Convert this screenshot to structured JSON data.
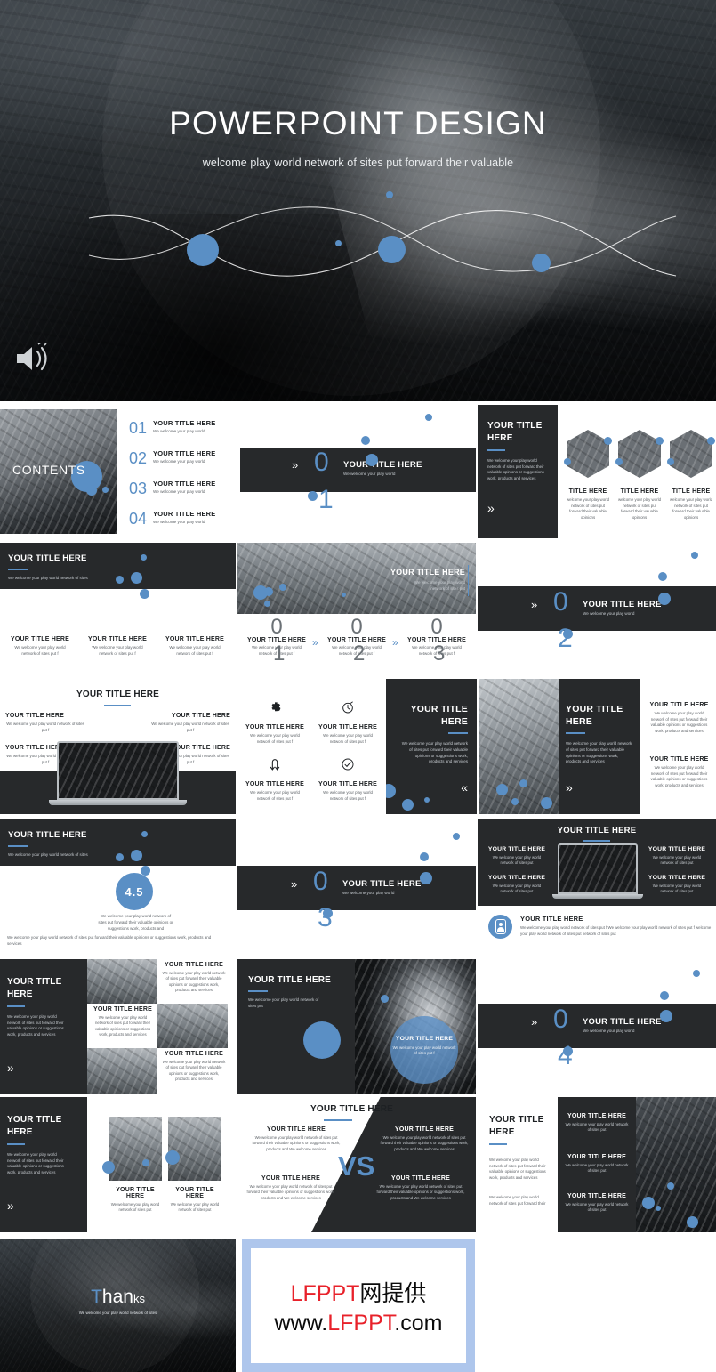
{
  "hero": {
    "title": "POWERPOINT DESIGN",
    "subtitle": "welcome play world network of sites put forward their valuable",
    "speaker_icon": "speaker-icon"
  },
  "accent_color": "#5a8fc5",
  "dark_color": "#27292b",
  "common": {
    "title": "YOUR TITLE HERE",
    "short_body": "We welcome your play world",
    "body_1": "We welcome your play world network of sites",
    "body_2": "We welcome your play world network of sites put f",
    "body_3": "We welcome your play world network of sites put forward their valuable opinions or suggestions work, products and services",
    "body_4": "We welcome your play world network of sites put forward their valuable opinions or suggestions work, products and",
    "body_5": "We welcome your play world network of sites put",
    "body_6": "We welcome your play world network of sites put forward their valuable opinions or suggestions work, products and We welcome services",
    "body_7": "We welcome your play world network of sites put forward their",
    "chevron_right": "»",
    "chevron_left": "«"
  },
  "slides": {
    "contents": {
      "label": "CONTENTS",
      "items": [
        {
          "num": "01",
          "title": "YOUR TITLE HERE",
          "body": "We welcome your play world"
        },
        {
          "num": "02",
          "title": "YOUR TITLE HERE",
          "body": "We welcome your play world"
        },
        {
          "num": "03",
          "title": "YOUR TITLE HERE",
          "body": "We welcome your play world"
        },
        {
          "num": "04",
          "title": "YOUR TITLE HERE",
          "body": "We welcome your play world"
        }
      ]
    },
    "section_1": {
      "zero": "0",
      "digit": "1",
      "title": "YOUR TITLE HERE",
      "body": "We welcome your play world"
    },
    "section_2": {
      "zero": "0",
      "digit": "2",
      "title": "YOUR TITLE HERE",
      "body": "We welcome your play world"
    },
    "section_3": {
      "zero": "0",
      "digit": "3",
      "title": "YOUR TITLE HERE",
      "body": "We welcome your play world"
    },
    "section_4": {
      "zero": "0",
      "digit": "4",
      "title": "YOUR TITLE HERE",
      "body": "We welcome your play world"
    },
    "intro_dark": {
      "title_line1": "YOUR TITLE",
      "title_line2": "HERE",
      "body": "We welcome your play world network of sites put forward their valuable opinions or suggestions work, products and services"
    },
    "team": {
      "members": [
        {
          "name": "TITLE HERE",
          "body": "welcome your play world network of sites put forward their valuable opinions"
        },
        {
          "name": "TITLE HERE",
          "body": "welcome your play world network of sites put forward their valuable opinions"
        },
        {
          "name": "TITLE HERE",
          "body": "welcome your play world network of sites put forward their valuable opinions"
        }
      ]
    },
    "three_col": {
      "header": "YOUR TITLE HERE",
      "header_body": "We welcome your play world network of sites",
      "cols": [
        {
          "title": "YOUR TITLE HERE",
          "body": "We welcome your play world network of sites put f"
        },
        {
          "title": "YOUR TITLE HERE",
          "body": "We welcome your play world network of sites put f"
        },
        {
          "title": "YOUR TITLE HERE",
          "body": "We welcome your play world network of sites put f"
        }
      ]
    },
    "steps": {
      "image_title": "YOUR TITLE HERE",
      "image_body": "We welcome your play world network of sites put",
      "items": [
        {
          "num": "0",
          "digit": "1",
          "title": "YOUR TITLE HERE",
          "body": "We welcome your play world network of sites put f"
        },
        {
          "num": "0",
          "digit": "2",
          "title": "YOUR TITLE HERE",
          "body": "We welcome your play world network of sites put f"
        },
        {
          "num": "0",
          "digit": "3",
          "title": "YOUR TITLE HERE",
          "body": "We welcome your play world network of sites put f"
        }
      ]
    },
    "laptop_four": {
      "header": "YOUR TITLE HERE",
      "items": [
        {
          "title": "YOUR TITLE HERE",
          "body": "We welcome your play world network of sites put f"
        },
        {
          "title": "YOUR TITLE HERE",
          "body": "We welcome your play world network of sites put f"
        },
        {
          "title": "YOUR TITLE HERE",
          "body": "We welcome your play world network of sites put f"
        },
        {
          "title": "YOUR TITLE HERE",
          "body": "We welcome your play world network of sites put f"
        }
      ]
    },
    "icons_four": {
      "items": [
        {
          "icon": "gear-icon",
          "title": "YOUR TITLE HERE",
          "body": "We welcome your play world network of sites put f"
        },
        {
          "icon": "stopwatch-icon",
          "title": "YOUR TITLE HERE",
          "body": "We welcome your play world network of sites put f"
        },
        {
          "icon": "exchange-arrows-icon",
          "title": "YOUR TITLE HERE",
          "body": "We welcome your play world network of sites put f"
        },
        {
          "icon": "check-circle-icon",
          "title": "YOUR TITLE HERE",
          "body": "We welcome your play world network of sites put f"
        }
      ]
    },
    "dark_text_panel": {
      "title_line1": "YOUR TITLE",
      "title_line2": "HERE",
      "body": "We welcome your play world network of sites put forward their valuable opinions or suggestions work, products and services"
    },
    "photo_text_panel": {
      "title_line1": "YOUR TITLE",
      "title_line2": "HERE",
      "body": "We welcome your play world network of sites put forward their valuable opinions or suggestions work, products and services"
    },
    "two_block_right": {
      "items": [
        {
          "title": "YOUR TITLE HERE",
          "body": "We welcome your play world network of sites put forward their valuable opinions or suggestions work, products and services"
        },
        {
          "title": "YOUR TITLE HERE",
          "body": "We welcome your play world network of sites put forward their valuable opinions or suggestions work, products and services"
        }
      ]
    },
    "rating": {
      "header": "YOUR TITLE HERE",
      "header_body": "We welcome your play world network of sites",
      "score": "4.5",
      "score_body": "We welcome your play world network of sites put forward their valuable opinions or suggestions work, products and",
      "footer": "We welcome your play world network of sites put forward their valuable opinions or suggestions work, products and services"
    },
    "dark_laptop": {
      "header": "YOUR TITLE HERE",
      "items": [
        {
          "title": "YOUR TITLE HERE",
          "body": "We welcome your play world network of sites put"
        },
        {
          "title": "YOUR TITLE HERE",
          "body": "We welcome your play world network of sites put"
        },
        {
          "title": "YOUR TITLE HERE",
          "body": "We welcome your play world network of sites put"
        },
        {
          "title": "YOUR TITLE HERE",
          "body": "We welcome your play world network of sites put"
        }
      ],
      "callout": {
        "icon": "person-badge-icon",
        "title": "YOUR TITLE HERE",
        "body": "We welcome your play world network of sites put f We welcome your play world network of sites put f welcome your play world network of sites put network of sites put"
      }
    },
    "mosaic": {
      "left": {
        "title_line1": "YOUR TITLE",
        "title_line2": "HERE",
        "body": "We welcome your play world network of sites put forward their valuable opinions or suggestions work, products and services"
      },
      "cards": [
        {
          "title": "YOUR TITLE HERE",
          "body": "We welcome your play world network of sites put forward their valuable opinions or suggestions work, products and services"
        },
        {
          "title": "YOUR TITLE HERE",
          "body": "We welcome your play world network of sites put forward their valuable opinions or suggestions work, products and services"
        },
        {
          "title": "YOUR TITLE HERE",
          "body": "We welcome your play world network of sites put forward their valuable opinions or suggestions work, products and services"
        }
      ]
    },
    "woman_circle": {
      "header": "YOUR TITLE HERE",
      "header_body": "We welcome your play world network of sites put",
      "circle_title": "YOUR TITLE HERE",
      "circle_body": "We welcome your play world network of sites put f"
    },
    "gallery_two": {
      "left_title_line1": "YOUR TITLE",
      "left_title_line2": "HERE",
      "left_body": "We welcome your play world network of sites put forward their valuable opinions or suggestions work, products and services",
      "cards": [
        {
          "title": "YOUR TITLE HERE",
          "body": "We welcome your play world network of sites put"
        },
        {
          "title": "YOUR TITLE HERE",
          "body": "We welcome your play world network of sites put"
        }
      ]
    },
    "versus": {
      "header": "YOUR TITLE HERE",
      "vs_label": "VS",
      "left": [
        {
          "title": "YOUR TITLE HERE",
          "body": "We welcome your play world network of sites put forward their valuable opinions or suggestions work, products and We welcome services"
        },
        {
          "title": "YOUR TITLE HERE",
          "body": "We welcome your play world network of sites put forward their valuable opinions or suggestions work, products and We welcome services"
        }
      ],
      "right": [
        {
          "title": "YOUR TITLE HERE",
          "body": "We welcome your play world network of sites put forward their valuable opinions or suggestions work, products and We welcome services"
        },
        {
          "title": "YOUR TITLE HERE",
          "body": "We welcome your play world network of sites put forward their valuable opinions or suggestions work, products and We welcome services"
        }
      ]
    },
    "list_right": {
      "title_line1": "YOUR TITLE",
      "title_line2": "HERE",
      "body_1": "We welcome your play world network of sites put forward their valuable opinions or suggestions work, products and services",
      "body_2": "We welcome your play world network of sites put forward their",
      "items": [
        {
          "title": "YOUR TITLE HERE",
          "body": "We welcome your play world network of sites put"
        },
        {
          "title": "YOUR TITLE HERE",
          "body": "We welcome your play world network of sites put"
        },
        {
          "title": "YOUR TITLE HERE",
          "body": "We welcome your play world network of sites put"
        }
      ]
    },
    "thanks": {
      "word_first": "T",
      "word_rest_big": "han",
      "word_rest_small": "ks",
      "body": "We welcome your play world network of sites"
    }
  },
  "watermark": {
    "line1_red": "LFPPT",
    "line1_black": "网提供",
    "line2_pre": "www.",
    "line2_red": "LFPPT",
    "line2_post": ".com"
  }
}
